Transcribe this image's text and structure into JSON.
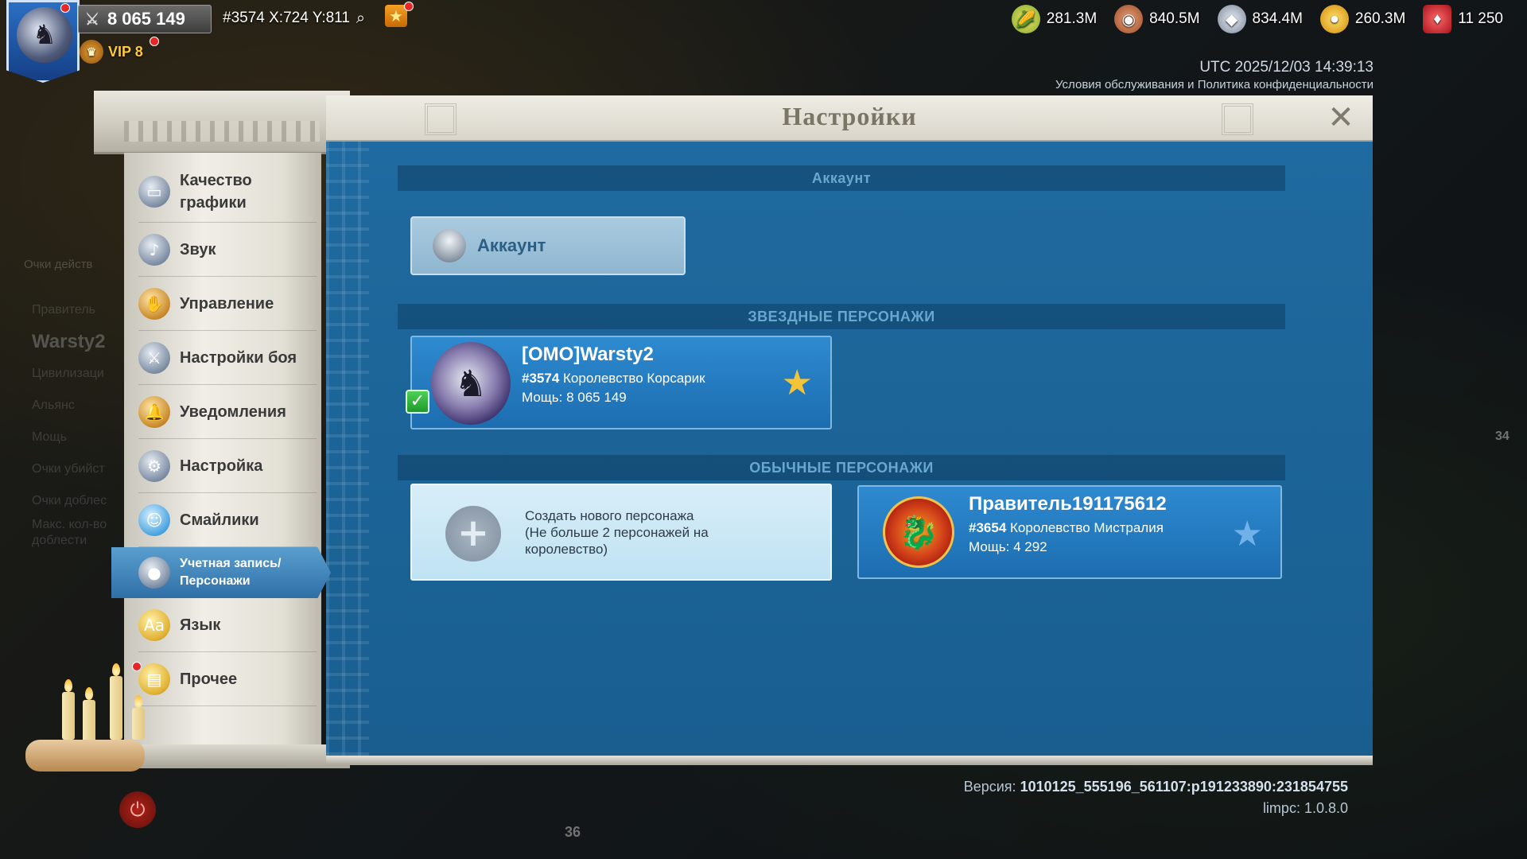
{
  "hud": {
    "power": "8 065 149",
    "coords": "#3574 X:724 Y:811",
    "vip": "VIP 8",
    "resources": [
      {
        "icon": "corn-icon",
        "value": "281.3M",
        "color": "#e3c23a"
      },
      {
        "icon": "wood-log-icon",
        "value": "840.5M",
        "color": "#c86a3a"
      },
      {
        "icon": "stone-icon",
        "value": "834.4M",
        "color": "#a8b4c4"
      },
      {
        "icon": "gold-coin-icon",
        "value": "260.3M",
        "color": "#f1b81c"
      },
      {
        "icon": "gem-icon",
        "value": "11 250",
        "color": "#d8242a"
      }
    ],
    "utc": "UTC 2025/12/03 14:39:13",
    "terms": "Условия обслуживания и Политика конфиденциальности"
  },
  "background": {
    "ghost_points": "Очки действ",
    "ghost_lines": [
      "Правитель",
      "Warsty2",
      "Цивилизаци",
      "Альянс",
      "Мощь",
      "Очки убийст",
      "Очки доблес",
      "Макс. кол-во доблести"
    ],
    "num_36": "36",
    "num_34": "34"
  },
  "panel": {
    "title": "Настройки",
    "account_section": "Аккаунт",
    "account_button": "Аккаунт",
    "star_section": "ЗВЕЗДНЫЕ ПЕРСОНАЖИ",
    "normal_section": "ОБЫЧНЫЕ ПЕРСОНАЖИ",
    "star_character": {
      "name": "[OMO]Warsty2",
      "kingdom_id": "#3574",
      "kingdom": "Королевство Корсарик",
      "power": "Мощь: 8 065 149"
    },
    "create_character": {
      "text": "Создать нового персонажа\n(Не больше 2 персонажей на королевство)"
    },
    "normal_character": {
      "name": "Правитель191175612",
      "kingdom_id": "#3654",
      "kingdom": "Королевство Мистралия",
      "power": "Мощь: 4 292"
    },
    "version_label": "Версия:",
    "version": "1010125_555196_561107:p191233890:231854755",
    "limpc": "limpc: 1.0.8.0"
  },
  "menu": [
    {
      "label": "Качество графики",
      "icon": "monitor-icon"
    },
    {
      "label": "Звук",
      "icon": "speaker-icon"
    },
    {
      "label": "Управление",
      "icon": "hand-icon"
    },
    {
      "label": "Настройки боя",
      "icon": "crossed-swords-icon"
    },
    {
      "label": "Уведомления",
      "icon": "bell-icon"
    },
    {
      "label": "Настройка",
      "icon": "gear-icon"
    },
    {
      "label": "Смайлики",
      "icon": "smiley-icon"
    },
    {
      "label": "Учетная запись/Персонажи",
      "icon": "account-icon",
      "active": true
    },
    {
      "label": "Язык",
      "icon": "language-icon"
    },
    {
      "label": "Прочее",
      "icon": "folder-icon"
    }
  ]
}
